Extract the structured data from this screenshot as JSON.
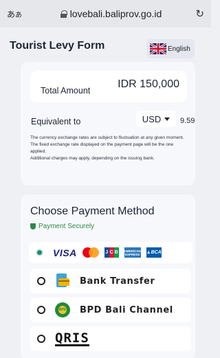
{
  "browser": {
    "text_size_label": "あ",
    "text_size_label_small": "あ",
    "url": "lovebali.baliprov.go.id"
  },
  "header": {
    "title": "Tourist Levy Form",
    "language_label": "English"
  },
  "amount": {
    "total_label": "Total Amount",
    "total_value": "IDR 150,000",
    "equivalent_label": "Equivalent to",
    "currency": "USD",
    "converted_value": "9.59",
    "disclaimer_line1": "The currency exchange rates are subject to fluctuation at any given moment. The fixed exchange rate displayed on the payment page will be the one applied.",
    "disclaimer_line2": "Additional charges may apply, depending on the issuing bank."
  },
  "payment": {
    "title": "Choose Payment Method",
    "secure_label": "Payment Securely",
    "card_logos": {
      "visa": "VISA",
      "jcb_letters": [
        "J",
        "C",
        "B"
      ],
      "amex_line1": "AMERICAN",
      "amex_line2": "EXPRESS",
      "bca": "BCA"
    },
    "methods": [
      {
        "label": "Bank Transfer"
      },
      {
        "label": "BPD Bali Channel"
      },
      {
        "label": "QRIS"
      }
    ]
  },
  "colors": {
    "accent_green": "#1e8a74",
    "secure_green": "#2f8a46",
    "text_dark": "#1d2433"
  }
}
